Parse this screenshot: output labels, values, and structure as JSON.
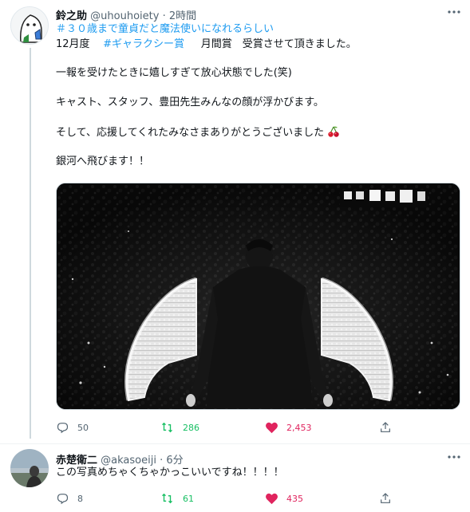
{
  "tweet": {
    "author_name": "鈴之助",
    "author_handle": "@uhouhoiety",
    "separator": "·",
    "time": "2時間",
    "more_icon": "ellipsis-icon",
    "hashtag_line": "＃３０歳まで童貞だと魔法使いになれるらしい",
    "line2_prefix": "12月度",
    "line2_hashtag": "#ギャラクシー賞",
    "line2_suffix": "月間賞　受賞させて頂きました。",
    "line3": "一報を受けたときに嬉しすぎて放心状態でした(笑)",
    "line4": "キャスト、スタッフ、豊田先生みんなの顔が浮かびます。",
    "line5": "そして、応援してくれたみなさまありがとうございました",
    "line5_emoji": "cherries-emoji",
    "line6": "銀河へ飛びます！！",
    "media_description_icon": "photo-angel-wings",
    "reply_count": "50",
    "retweet_count": "286",
    "like_count": "2,453",
    "colors": {
      "retweet": "#17bf63",
      "like": "#e0245e",
      "link": "#1d9bf0",
      "muted": "#536471"
    }
  },
  "reply": {
    "author_name": "赤楚衛二",
    "author_handle": "@akasoeiji",
    "separator": "·",
    "time": "6分",
    "text": "この写真めちゃくちゃかっこいいですね！！！！",
    "reply_count": "8",
    "retweet_count": "61",
    "like_count": "435"
  }
}
